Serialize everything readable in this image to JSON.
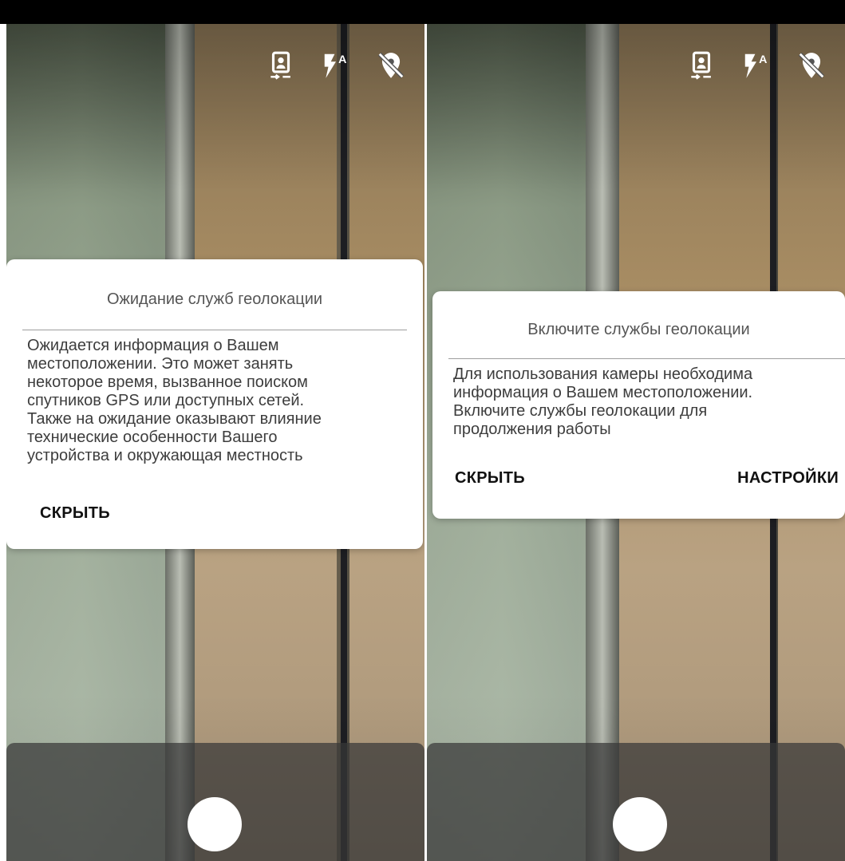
{
  "screens": [
    {
      "icons": [
        "switch-camera-icon",
        "flash-auto-icon",
        "location-off-icon"
      ],
      "flash_label": "A",
      "dialog": {
        "title": "Ожидание служб геолокации",
        "message_lines": [
          "Ожидается информация о Вашем",
          "местоположении. Это может занять",
          "некоторое время, вызванное поиском",
          "спутников GPS или доступных сетей.",
          "Также на ожидание оказывают влияние",
          "технические особенности Вашего",
          "устройства и окружающая местность"
        ],
        "hide_label": "СКРЫТЬ"
      }
    },
    {
      "icons": [
        "switch-camera-icon",
        "flash-auto-icon",
        "location-off-icon"
      ],
      "flash_label": "A",
      "dialog": {
        "title": "Включите службы геолокации",
        "message_lines": [
          "Для использования камеры необходима",
          "информация о Вашем местоположении.",
          "Включите службы геолокации для",
          "продолжения работы"
        ],
        "hide_label": "СКРЫТЬ",
        "settings_label": "НАСТРОЙКИ"
      }
    }
  ],
  "colors": {
    "dialog_background": "#ffffff",
    "title_text": "#555555",
    "body_text": "#3d3d3d",
    "button_text": "#111111",
    "divider": "#9e9e9e"
  }
}
